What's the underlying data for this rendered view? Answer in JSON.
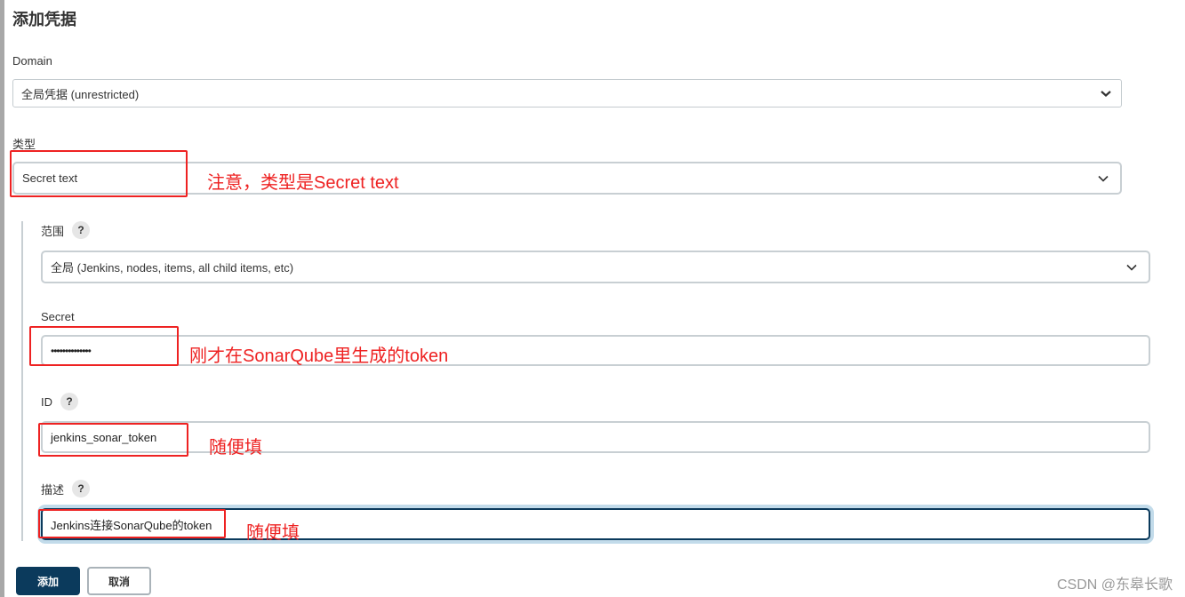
{
  "page": {
    "title": "添加凭据"
  },
  "form": {
    "domain": {
      "label": "Domain",
      "value": "全局凭据 (unrestricted)"
    },
    "kind": {
      "label": "类型",
      "value": "Secret text"
    },
    "scope": {
      "label": "范围",
      "help": "?",
      "value": "全局 (Jenkins, nodes, items, all child items, etc)"
    },
    "secret": {
      "label": "Secret",
      "value": "••••••••••••••"
    },
    "id": {
      "label": "ID",
      "help": "?",
      "value": "jenkins_sonar_token"
    },
    "description": {
      "label": "描述",
      "help": "?",
      "value": "Jenkins连接SonarQube的token"
    }
  },
  "buttons": {
    "add": "添加",
    "cancel": "取消"
  },
  "annotations": {
    "kind_note": "注意，类型是Secret text",
    "secret_note": "刚才在SonarQube里生成的token",
    "id_note": "随便填",
    "description_note": "随便填",
    "color": "#ee2222"
  },
  "watermark": "CSDN @东皋长歌",
  "colors": {
    "primary": "#0b3a5c",
    "focus_ring": "#c2dbea",
    "border": "#c8cfd3"
  }
}
